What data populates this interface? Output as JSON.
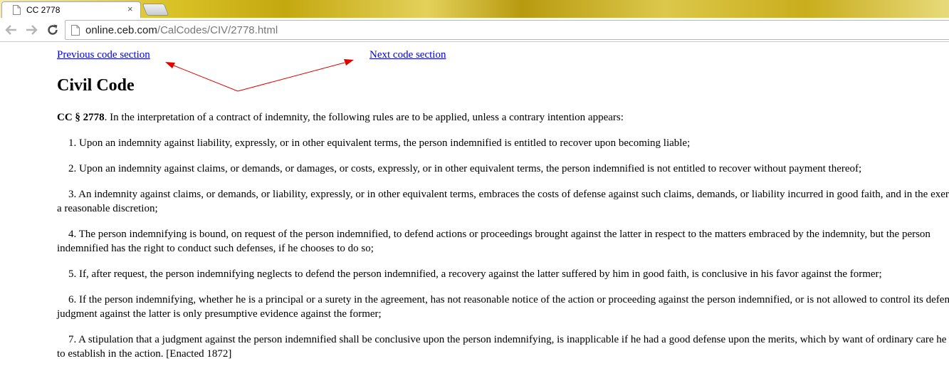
{
  "browser": {
    "tab_title": "CC 2778",
    "tab_close": "×",
    "url_host": "online.ceb.com",
    "url_path": "/CalCodes/CIV/2778.html"
  },
  "nav": {
    "previous": "Previous code section",
    "next": "Next code section"
  },
  "page_title": "Civil Code",
  "section": {
    "label": "CC § 2778",
    "intro": ". In the interpretation of a contract of indemnity, the following rules are to be applied, unless a contrary intention appears:"
  },
  "rules": [
    "1. Upon an indemnity against liability, expressly, or in other equivalent terms, the person indemnified is entitled to recover upon becoming liable;",
    "2. Upon an indemnity against claims, or demands, or damages, or costs, expressly, or in other equivalent terms, the person indemnified is not entitled to recover without payment thereof;",
    "3. An indemnity against claims, or demands, or liability, expressly, or in other equivalent terms, embraces the costs of defense against such claims, demands, or liability incurred in good faith, and in the exercise of a reasonable discretion;",
    "4. The person indemnifying is bound, on request of the person indemnified, to defend actions or proceedings brought against the latter in respect to the matters embraced by the indemnity, but the person indemnified has the right to conduct such defenses, if he chooses to do so;",
    "5. If, after request, the person indemnifying neglects to defend the person indemnified, a recovery against the latter suffered by him in good faith, is conclusive in his favor against the former;",
    "6. If the person indemnifying, whether he is a principal or a surety in the agreement, has not reasonable notice of the action or proceeding against the person indemnified, or is not allowed to control its defense, judgment against the latter is only presumptive evidence against the former;",
    "7. A stipulation that a judgment against the person indemnified shall be conclusive upon the person indemnifying, is inapplicable if he had a good defense upon the merits, which by want of ordinary care he failed to establish in the action. [Enacted 1872]"
  ],
  "annotation": {
    "arrow_color": "#e00000"
  }
}
